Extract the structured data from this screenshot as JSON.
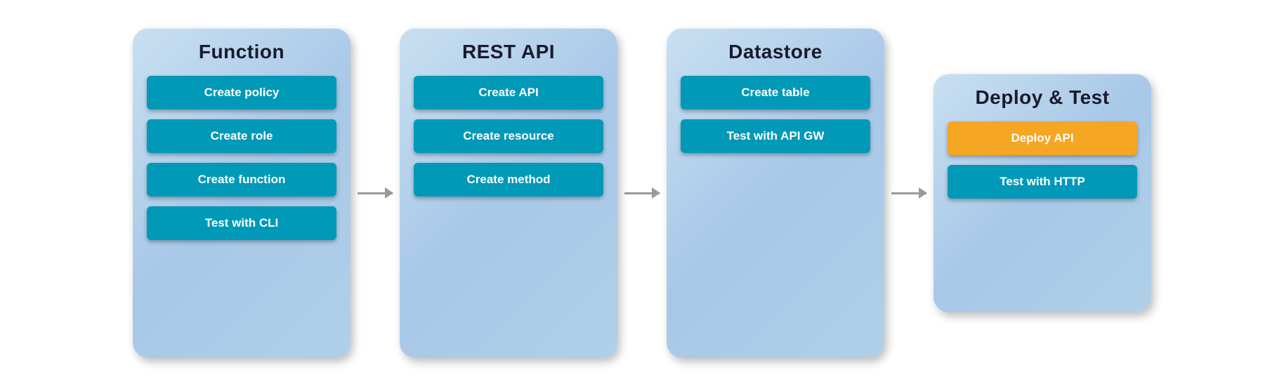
{
  "columns": [
    {
      "id": "function",
      "title": "Function",
      "items": [
        {
          "id": "create-policy",
          "label": "Create policy",
          "color": "teal"
        },
        {
          "id": "create-role",
          "label": "Create role",
          "color": "teal"
        },
        {
          "id": "create-function",
          "label": "Create function",
          "color": "teal"
        },
        {
          "id": "test-cli",
          "label": "Test with CLI",
          "color": "teal"
        }
      ]
    },
    {
      "id": "rest-api",
      "title": "REST API",
      "items": [
        {
          "id": "create-api",
          "label": "Create API",
          "color": "teal"
        },
        {
          "id": "create-resource",
          "label": "Create resource",
          "color": "teal"
        },
        {
          "id": "create-method",
          "label": "Create method",
          "color": "teal"
        }
      ]
    },
    {
      "id": "datastore",
      "title": "Datastore",
      "items": [
        {
          "id": "create-table",
          "label": "Create table",
          "color": "teal"
        },
        {
          "id": "test-api-gw",
          "label": "Test with API GW",
          "color": "teal"
        }
      ]
    },
    {
      "id": "deploy-test",
      "title": "Deploy & Test",
      "items": [
        {
          "id": "deploy-api",
          "label": "Deploy API",
          "color": "orange"
        },
        {
          "id": "test-http",
          "label": "Test with HTTP",
          "color": "teal"
        }
      ]
    }
  ],
  "arrows": [
    "arrow1",
    "arrow2",
    "arrow3"
  ]
}
